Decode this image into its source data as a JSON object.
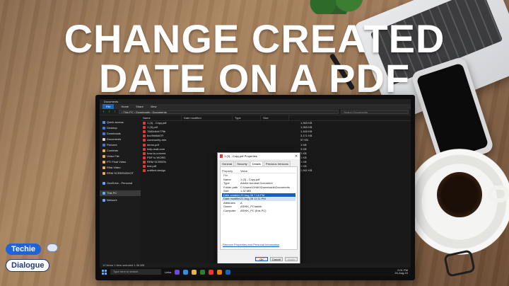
{
  "headline": {
    "line1": "CHANGE CREATED",
    "line2": "DATE ON A PDF"
  },
  "brand": {
    "line1": "Techie",
    "line2": "Dialogue"
  },
  "explorer": {
    "window_title": "Documents",
    "ribbon_tabs": [
      "File",
      "Home",
      "Share",
      "View"
    ],
    "address": "› This PC › Downloads › Documents",
    "search_placeholder": "Search Documents",
    "columns": [
      "Name",
      "Date modified",
      "Type",
      "Size"
    ],
    "sidebar": [
      {
        "label": "Quick access"
      },
      {
        "label": "Desktop"
      },
      {
        "label": "Downloads"
      },
      {
        "label": "Documents"
      },
      {
        "label": "Pictures"
      },
      {
        "label": "Contents"
      },
      {
        "label": "Video File"
      },
      {
        "label": "PTI Final Video"
      },
      {
        "label": "Rifat Video"
      },
      {
        "label": "RRM SCREENSHOT"
      },
      {
        "label": "OneDrive - Personal"
      },
      {
        "label": "This PC"
      },
      {
        "label": "Network"
      }
    ],
    "files": [
      {
        "name": "1 (3) - Copy.pdf",
        "size": "1,363 KB"
      },
      {
        "name": "1 (3).pdf",
        "size": "1,363 KB"
      },
      {
        "name": "7680c6cb779b",
        "size": "1,163 KB"
      },
      {
        "name": "bcc9bb6d07f",
        "size": "3,171 KB"
      },
      {
        "name": "community-rele",
        "size": "57 KB"
      },
      {
        "name": "demo.pdf",
        "size": "1 KB"
      },
      {
        "name": "help-mail-com",
        "size": "3 KB"
      },
      {
        "name": "how-to-convert",
        "size": "1 KB"
      },
      {
        "name": "PDF to WORD",
        "size": "1 KB"
      },
      {
        "name": "RRM SCREEN",
        "size": "1 KB"
      },
      {
        "name": "test.pdf",
        "size": "1 KB"
      },
      {
        "name": "untitled-design",
        "size": "2,861 KB"
      }
    ],
    "status": "12 items    1 item selected  1.36 MB"
  },
  "dialog": {
    "title": "1 (3) - Copy.pdf Properties",
    "tabs": [
      "General",
      "Security",
      "Details",
      "Previous Versions"
    ],
    "active_tab": "Details",
    "header": {
      "property": "Property",
      "value": "Value"
    },
    "group_file": "File",
    "rows": [
      {
        "k": "Name",
        "v": "1 (3) - Copy.pdf"
      },
      {
        "k": "Type",
        "v": "Adobe Acrobat Document"
      },
      {
        "k": "Folder path",
        "v": "C:\\Users\\GHAV\\Downloads\\Documents"
      },
      {
        "k": "Size",
        "v": "1.32 MB"
      },
      {
        "k": "Date created",
        "v": "29 Aug 08 7:16 PM"
      },
      {
        "k": "Date modified",
        "v": "21 Aug 28 11:11 PM"
      },
      {
        "k": "Attributes",
        "v": "A"
      },
      {
        "k": "Owner",
        "v": "ASHIK_PC\\ashik"
      },
      {
        "k": "Computer",
        "v": "ASHIK_PC (this PC)"
      }
    ],
    "highlighted_row": "Date created",
    "remove_link": "Remove Properties and Personal Information",
    "buttons": {
      "ok": "OK",
      "cancel": "Cancel",
      "apply": "Apply"
    }
  },
  "taskbar": {
    "search_placeholder": "Type here to search",
    "links_label": "Links",
    "time": "2:01 PM",
    "date": "24-Aug-24"
  },
  "colors": {
    "headline": "#ffffff",
    "accent_blue": "#0a64c8",
    "brand_blue": "#1e63d8",
    "pdf_red": "#e53935"
  }
}
